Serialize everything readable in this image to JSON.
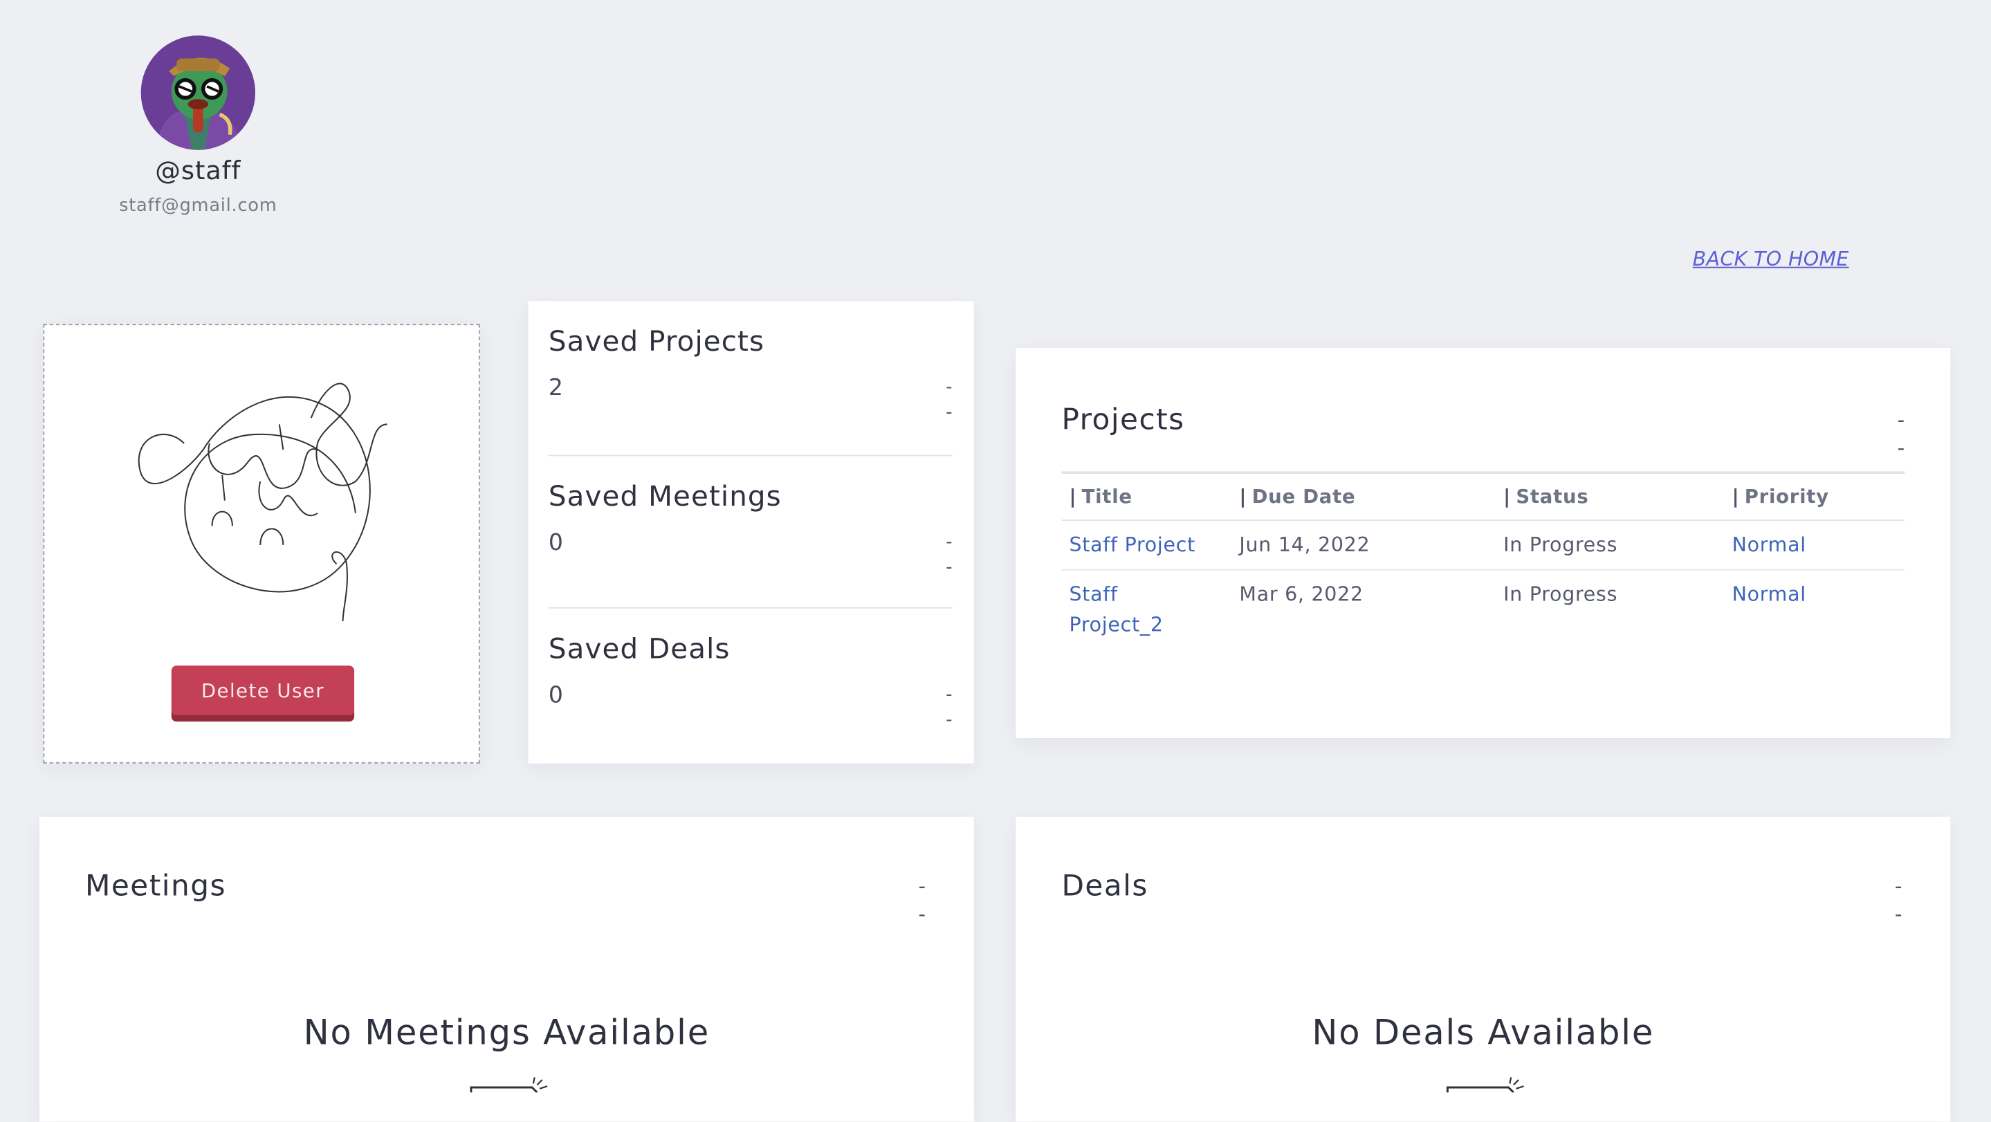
{
  "profile": {
    "username": "@staff",
    "email": "staff@gmail.com"
  },
  "nav": {
    "back_to_home": "BACK TO HOME"
  },
  "signature_card": {
    "delete_button": "Delete User"
  },
  "saved": [
    {
      "title": "Saved Projects",
      "count": "2",
      "dash_top": "-",
      "dash_bottom": "-"
    },
    {
      "title": "Saved Meetings",
      "count": "0",
      "dash_top": "-",
      "dash_bottom": "-"
    },
    {
      "title": "Saved Deals",
      "count": "0",
      "dash_top": "-",
      "dash_bottom": "-"
    }
  ],
  "projects": {
    "title": "Projects",
    "dash_top": "-",
    "dash_bottom": "-",
    "columns": [
      "Title",
      "Due Date",
      "Status",
      "Priority"
    ],
    "column_marker": "|",
    "rows": [
      {
        "title": "Staff Project",
        "due": "Jun 14, 2022",
        "status": "In Progress",
        "priority": "Normal"
      },
      {
        "title": "Staff Project_2",
        "due": "Mar 6, 2022",
        "status": "In Progress",
        "priority": "Normal"
      }
    ]
  },
  "meetings": {
    "title": "Meetings",
    "dash_top": "-",
    "dash_bottom": "-",
    "empty_message": "No Meetings Available"
  },
  "deals": {
    "title": "Deals",
    "dash_top": "-",
    "dash_bottom": "-",
    "empty_message": "No Deals Available"
  },
  "icons": {
    "avatar": "avatar-illustration",
    "signature": "signature-drawing",
    "empty": "empty-box-icon"
  },
  "colors": {
    "background": "#eeeff3",
    "link": "#5b5fd6",
    "table_link": "#3e64b8",
    "delete_button": "#c34057"
  }
}
